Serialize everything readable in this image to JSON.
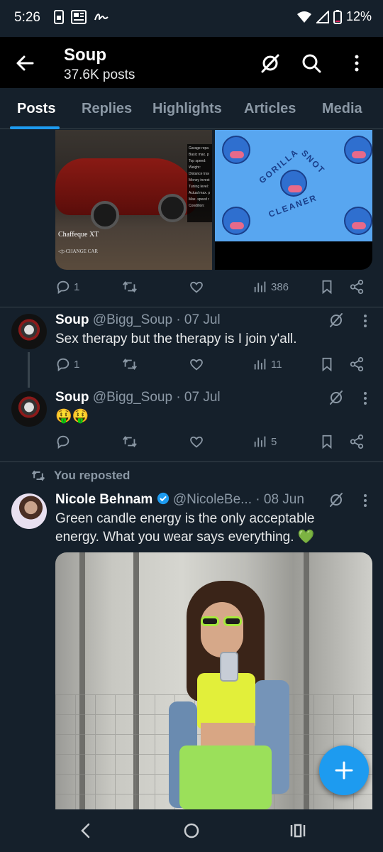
{
  "status_bar": {
    "time": "5:26",
    "battery": "12%",
    "icons": [
      "sim-card-icon",
      "news-icon",
      "signature-icon",
      "wifi-icon",
      "signal-icon",
      "battery-icon"
    ]
  },
  "header": {
    "title": "Soup",
    "subtitle": "37.6K posts",
    "icons": [
      "back-arrow-icon",
      "grok-icon",
      "search-icon",
      "more-vertical-icon"
    ]
  },
  "tabs": [
    {
      "label": "Posts",
      "active": true
    },
    {
      "label": "Replies",
      "active": false
    },
    {
      "label": "Highlights",
      "active": false
    },
    {
      "label": "Articles",
      "active": false
    },
    {
      "label": "Media",
      "active": false
    }
  ],
  "top_post": {
    "media": {
      "car_caption": "Chaffeque XT",
      "car_subcaption": "◁▷CHANGE CAR",
      "car_panel_lines": [
        "Garage repa",
        "Basic max. p",
        "Top speed:",
        "Weight:",
        "Distance trav",
        "Money invest",
        "Tuning level:",
        "Actual max. p",
        "Max. speed r",
        "Condition:"
      ],
      "logo_words": [
        "GORILLA",
        "SNOT",
        "CLEANER"
      ]
    },
    "views": "386"
  },
  "posts": [
    {
      "name": "Soup",
      "handle": "@Bigg_Soup",
      "date": "· 07 Jul",
      "text": "Sex therapy but the therapy is I join y'all.",
      "views": "11"
    },
    {
      "name": "Soup",
      "handle": "@Bigg_Soup",
      "date": "· 07 Jul",
      "text": "🤑🤑",
      "views": "5"
    }
  ],
  "repost": {
    "label": "You reposted",
    "name": "Nicole Behnam",
    "handle": "@NicoleBe...",
    "date": "· 08 Jun",
    "text_line1": "Green candle energy is the only acceptable",
    "text_line2": "energy. What you wear says everything. 💚"
  },
  "colors": {
    "background": "#15202b",
    "header": "#000000",
    "accent": "#1d9bf0",
    "muted": "#8b98a5",
    "divider": "#38444d",
    "verified": "#1d9bf0"
  },
  "fab": {
    "icon": "plus-icon"
  },
  "nav": {
    "icons": [
      "nav-back-icon",
      "nav-home-icon",
      "nav-recents-icon"
    ]
  }
}
